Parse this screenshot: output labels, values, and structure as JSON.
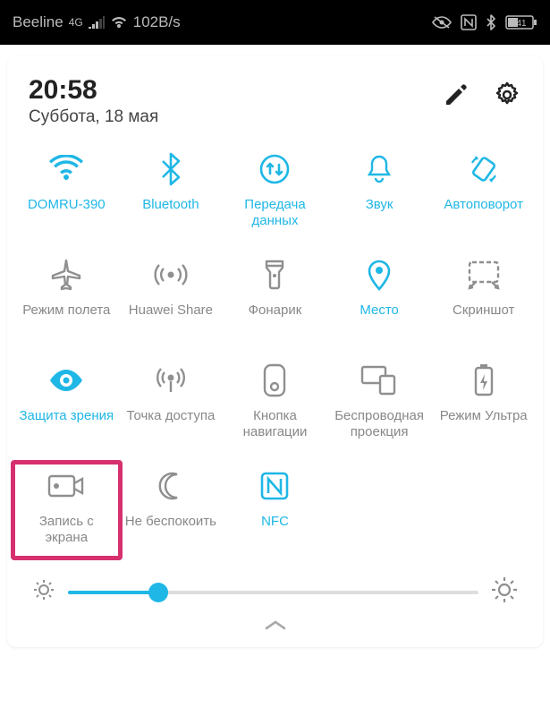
{
  "statusBar": {
    "carrier": "Beeline",
    "networkType": "4G",
    "dataRate": "102B/s",
    "batteryPercent": "41"
  },
  "header": {
    "time": "20:58",
    "date": "Суббота, 18 мая"
  },
  "tiles": [
    {
      "id": "wifi",
      "label": "DOMRU-390",
      "active": true
    },
    {
      "id": "bluetooth",
      "label": "Bluetooth",
      "active": true
    },
    {
      "id": "mobiledata",
      "label": "Передача данных",
      "active": true
    },
    {
      "id": "sound",
      "label": "Звук",
      "active": true
    },
    {
      "id": "autorotate",
      "label": "Автоповорот",
      "active": true
    },
    {
      "id": "airplane",
      "label": "Режим полета",
      "active": false
    },
    {
      "id": "huaweishare",
      "label": "Huawei Share",
      "active": false
    },
    {
      "id": "flashlight",
      "label": "Фонарик",
      "active": false
    },
    {
      "id": "location",
      "label": "Место",
      "active": true
    },
    {
      "id": "screenshot",
      "label": "Скриншот",
      "active": false
    },
    {
      "id": "eyecomfort",
      "label": "Защита зрения",
      "active": true
    },
    {
      "id": "hotspot",
      "label": "Точка доступа",
      "active": false
    },
    {
      "id": "navdot",
      "label": "Кнопка навигации",
      "active": false
    },
    {
      "id": "cast",
      "label": "Беспроводная проекция",
      "active": false
    },
    {
      "id": "ultra",
      "label": "Режим Ультра",
      "active": false
    },
    {
      "id": "screenrec",
      "label": "Запись с экрана",
      "active": false
    },
    {
      "id": "dnd",
      "label": "Не беспокоить",
      "active": false
    },
    {
      "id": "nfc",
      "label": "NFC",
      "active": true
    }
  ],
  "brightness": {
    "percent": 22
  },
  "colors": {
    "active": "#1fb7e6",
    "inactive": "#8f8f8f",
    "highlight": "#d6306f"
  }
}
